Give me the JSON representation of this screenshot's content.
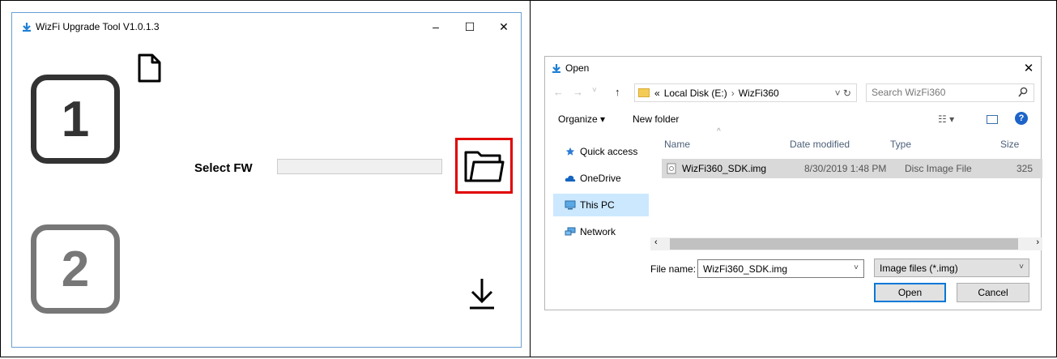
{
  "left_window": {
    "title": "WizFi Upgrade Tool V1.0.1.3",
    "controls": {
      "minimize": "–",
      "maximize": "☐",
      "close": "✕"
    },
    "step1": "1",
    "step2": "2",
    "select_fw_label": "Select FW",
    "fw_path_value": ""
  },
  "open_dialog": {
    "title": "Open",
    "close": "✕",
    "nav": {
      "back": "←",
      "forward": "→",
      "recent": "˅",
      "up": "↑"
    },
    "breadcrumb": {
      "overflow": "«",
      "items": [
        "Local Disk (E:)",
        "WizFi360"
      ],
      "sep": "›"
    },
    "address_controls": "˅  ↻",
    "search_placeholder": "Search WizFi360",
    "toolbar": {
      "organize": "Organize ▾",
      "new_folder": "New folder",
      "view": "☷ ▾",
      "help": "?"
    },
    "sidebar": [
      "Quick access",
      "OneDrive",
      "This PC",
      "Network"
    ],
    "columns": {
      "name": "Name",
      "date_modified": "Date modified",
      "type": "Type",
      "size": "Size"
    },
    "files": [
      {
        "name": "WizFi360_SDK.img",
        "date": "8/30/2019 1:48 PM",
        "type": "Disc Image File",
        "size": "325"
      }
    ],
    "file_name_label": "File name:",
    "file_name_value": "WizFi360_SDK.img",
    "file_type_value": "Image files (*.img)",
    "open_button": "Open",
    "cancel_button": "Cancel"
  },
  "colors": {
    "highlight_red": "#e00000",
    "accent_blue": "#0078d7",
    "selection": "#cce8ff"
  }
}
